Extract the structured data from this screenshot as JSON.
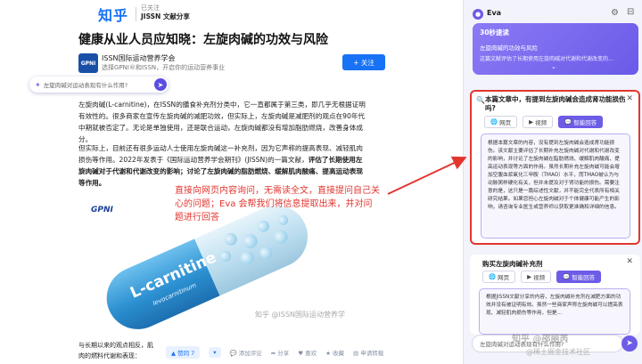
{
  "header": {
    "logo": "知乎",
    "crumb_sub": "已关注",
    "crumb_title": "JISSN 文献分享"
  },
  "article": {
    "title": "健康从业人员应知晓：左旋肉碱的功效与风险",
    "author_logo": "GPNI",
    "author_name": "ISSN国际运动营养学会",
    "author_desc": "选择GPNI®和ISSN，开启你的运动营养事业",
    "follow_label": "+ 关注",
    "ask_placeholder": "左旋肉碱对运动表现有什么作用?",
    "para1": "左旋肉碱(L-carnitine)，在ISSN的膳食补充剂分类中，它一直都属于第三类，即几乎无根据证明有效性的。很多商家在宣传左旋肉碱的减肥功效，但实际上，左旋肉碱是减肥剂的观点在90年代中期就被否定了。无论是单独使用，还是联合运动，左旋肉碱都没有增加脂肪燃烧，改善身体成分。",
    "para2_a": "但实际上，目前还有很多运动人士使用左旋肉碱这一补充剂，因为它声称的提高表现、减轻肌肉损伤等作用。2022年发表于《国际运动营养学会期刊》(JISSN)的一篇文献，",
    "para2_b": "评估了长期使用左旋肉碱对于代谢和代谢改变的影响；讨论了左旋肉碱的脂肪燃烧、缓解肌肉酸痛、提高运动表现等作用。",
    "annotation": "直接向网页内容询问，无需读全文，直接提问自己关心的问题；Eva 会帮我们将信息提取出来，并对问题进行回答",
    "gpni_label": "GPNI",
    "capsule_title": "L-carnitine",
    "capsule_sub": "levocarnitinum",
    "watermark": "知乎 @ISSN国际运动营养学",
    "bottom_text": "与长期以来的观点相反，肌肉的燃料代谢和表现：",
    "actions": [
      "赞同 7",
      "▾",
      "添加评论",
      "分享",
      "喜欢",
      "收藏",
      "申请转载"
    ]
  },
  "panel": {
    "name": "Eva",
    "summary_badge": "30秒速读",
    "summary_title": "左旋肉碱的功效与风险",
    "summary_desc": "这篇文献评估了长期使用左旋肉碱对代谢和代谢改变的...",
    "qa1": {
      "question": "本篇文章中，有提到左旋肉碱会造成肾功能损伤吗?",
      "tabs": [
        "网页",
        "视频",
        "智能回答"
      ],
      "answer": "根据本篇文章的内容，没有提到左旋肉碱会造成肾功能损伤。该文献主要评估了长期补充左旋肉碱对代谢和代谢改变的影响，并讨论了左旋肉碱在脂肪燃烧、缓解肌肉酸痛、提高运动表现等方面的作用。虽然长期补充左旋肉碱可能会增加空腹血浆氧化三甲胺（TMAO）水平，而TMAO被认为与动脉粥样硬化有关，但并未提及对于肾功能的损伤。需要注意的是，这只是一篇综述性文献，并不能完全代表所有相关研究结果。如果您担心左旋肉碱对于个体健康可能产生的影响，请咨询专业医生或营养师以获取更准确和详细的信息。"
    },
    "qa2": {
      "question": "购买左旋肉碱补充剂",
      "tabs": [
        "网页",
        "视频",
        "智能回答"
      ],
      "answer": "根据JISSN文献分享的内容，左旋肉碱补充剂在减肥方面的功效并没有被证明有效。虽然一些商家声称左旋肉碱可以提高表现、减轻肌肉损伤等作用，但是..."
    },
    "input_placeholder": "左旋肉碱对运动表现有什么作用?",
    "wm_line1": "知乎 @邵丽芮",
    "wm_line2": "@稀土掘金技术社区"
  }
}
